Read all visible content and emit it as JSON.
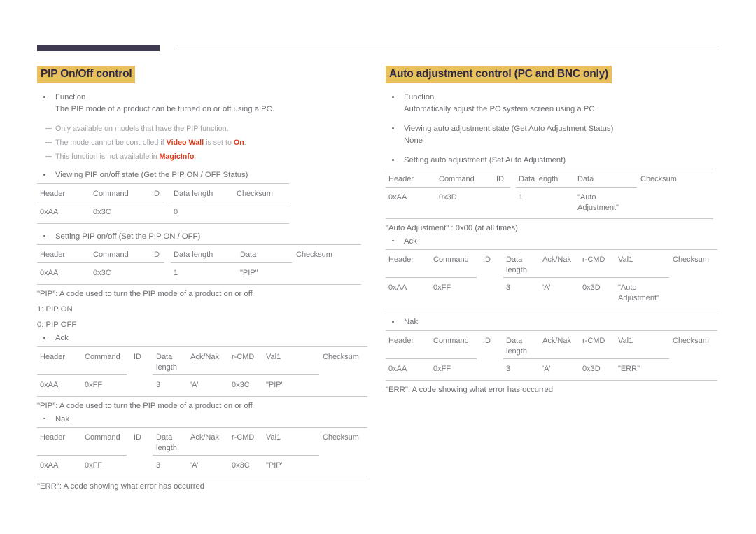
{
  "page": {
    "top_rule": {
      "tab_color": "#3f3a51",
      "line_color": "#8c8c92"
    },
    "highlight_color": "#e9c15c",
    "title_text_color": "#2e2a45",
    "accent_red": "#e03b1c"
  },
  "left": {
    "title": "PIP On/Off control",
    "bullets": {
      "function_label": "Function",
      "function_desc": "The PIP mode of a product can be turned on or off using a PC.",
      "viewing_state": "Viewing PIP on/off state (Get the PIP ON / OFF Status)",
      "setting_state": "Setting PIP on/off (Set the PIP ON / OFF)",
      "ack": "Ack",
      "nak": "Nak"
    },
    "notes": [
      {
        "pre": "Only available on models that have the PIP function.",
        "bold": "",
        "post": ""
      },
      {
        "pre": "The mode cannot be controlled if ",
        "bold": "Video Wall",
        "mid": " is set to ",
        "bold2": "On",
        "post": "."
      },
      {
        "pre": "This function is not available in ",
        "bold": "MagicInfo",
        "post": "."
      }
    ],
    "table_get": {
      "headers": [
        "Header",
        "Command",
        "ID",
        "Data length",
        "Checksum"
      ],
      "values": [
        "0xAA",
        "0x3C",
        "",
        "0",
        ""
      ]
    },
    "table_set": {
      "headers": [
        "Header",
        "Command",
        "ID",
        "Data length",
        "Data",
        "Checksum"
      ],
      "values": [
        "0xAA",
        "0x3C",
        "",
        "1",
        "\"PIP\"",
        ""
      ]
    },
    "pip_desc": "\"PIP\": A code used to turn the PIP mode of a product on or off",
    "pip_on": "1: PIP ON",
    "pip_off": "0: PIP OFF",
    "table_ack": {
      "headers": [
        "Header",
        "Command",
        "ID",
        "Data\nlength",
        "Ack/Nak",
        "r-CMD",
        "Val1",
        "Checksum"
      ],
      "values": [
        "0xAA",
        "0xFF",
        "",
        "3",
        "'A'",
        "0x3C",
        "\"PIP\"",
        ""
      ]
    },
    "pip_desc2": "\"PIP\": A code used to turn the PIP mode of a product on or off",
    "table_nak": {
      "headers": [
        "Header",
        "Command",
        "ID",
        "Data\nlength",
        "Ack/Nak",
        "r-CMD",
        "Val1",
        "Checksum"
      ],
      "values": [
        "0xAA",
        "0xFF",
        "",
        "3",
        "'A'",
        "0x3C",
        "\"PIP\"",
        ""
      ]
    },
    "err_desc": "\"ERR\": A code showing what error has occurred"
  },
  "right": {
    "title": "Auto adjustment control (PC and BNC only)",
    "bullets": {
      "function_label": "Function",
      "function_desc": "Automatically adjust the PC system screen using a PC.",
      "viewing_state": "Viewing auto adjustment state (Get Auto Adjustment Status)",
      "viewing_state_value": "None",
      "setting_state": "Setting auto adjustment (Set Auto Adjustment)",
      "ack": "Ack",
      "nak": "Nak"
    },
    "table_set": {
      "headers": [
        "Header",
        "Command",
        "ID",
        "Data length",
        "Data",
        "Checksum"
      ],
      "values": [
        "0xAA",
        "0x3D",
        "",
        "1",
        "\"Auto\nAdjustment\"",
        ""
      ]
    },
    "auto_adj_desc": "\"Auto Adjustment\" : 0x00 (at all times)",
    "table_ack": {
      "headers": [
        "Header",
        "Command",
        "ID",
        "Data\nlength",
        "Ack/Nak",
        "r-CMD",
        "Val1",
        "Checksum"
      ],
      "values": [
        "0xAA",
        "0xFF",
        "",
        "3",
        "'A'",
        "0x3D",
        "\"Auto\nAdjustment\"",
        ""
      ]
    },
    "table_nak": {
      "headers": [
        "Header",
        "Command",
        "ID",
        "Data\nlength",
        "Ack/Nak",
        "r-CMD",
        "Val1",
        "Checksum"
      ],
      "values": [
        "0xAA",
        "0xFF",
        "",
        "3",
        "'A'",
        "0x3D",
        "\"ERR\"",
        ""
      ]
    },
    "err_desc": "\"ERR\": A code showing what error has occurred"
  }
}
